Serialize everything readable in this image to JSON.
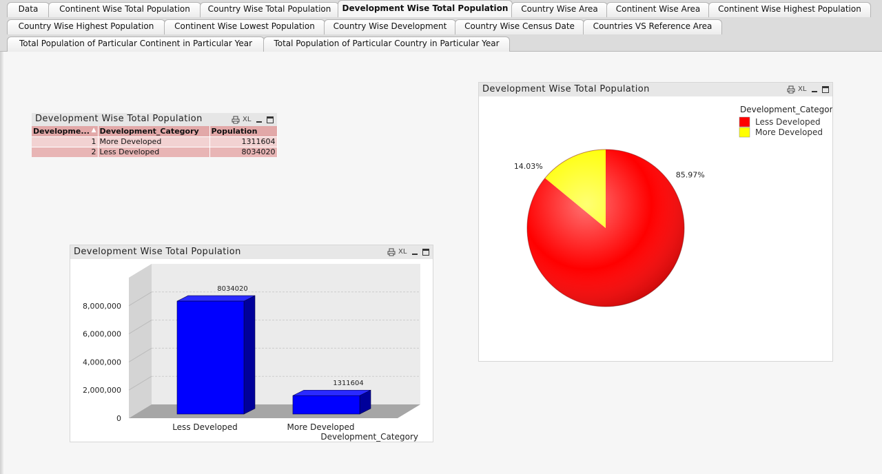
{
  "tabs": {
    "row1": [
      "Data",
      "Continent Wise Total Population",
      "Country Wise Total Population",
      "Development Wise Total Population",
      "Country Wise Area",
      "Continent Wise Area",
      "Continent Wise Highest Population"
    ],
    "row2": [
      "Country Wise Highest Population",
      "Continent Wise Lowest Population",
      "Country Wise Development",
      "Country Wise Census Date",
      "Countries VS Reference Area"
    ],
    "row3": [
      "Total Population of Particular Continent in Particular Year",
      "Total Population of Particular Country in Particular Year"
    ],
    "active": "Development Wise Total Population"
  },
  "caption_icons": {
    "print": "printer-icon",
    "excel": "XL",
    "minimize": "minimize-icon",
    "maximize": "maximize-icon"
  },
  "table": {
    "title": "Development Wise Total Population",
    "columns": [
      "Developme...",
      "Development_Category",
      "Population"
    ],
    "rows": [
      [
        "1",
        "More Developed",
        "1311604"
      ],
      [
        "2",
        "Less Developed",
        "8034020"
      ]
    ]
  },
  "pie": {
    "title": "Development Wise Total Population",
    "legend_title": "Development_Category",
    "colors": {
      "Less Developed": "#ff0000",
      "More Developed": "#ffff00"
    },
    "labels": [
      "14.03%",
      "85.97%"
    ]
  },
  "bar": {
    "title": "Development Wise Total Population",
    "xlabel": "Development_Category",
    "bar_color": "#0000ff"
  },
  "chart_data": [
    {
      "type": "pie",
      "title": "Development Wise Total Population",
      "legend_title": "Development_Category",
      "categories": [
        "Less Developed",
        "More Developed"
      ],
      "values": [
        85.97,
        14.03
      ],
      "legend_position": "top-right"
    },
    {
      "type": "bar",
      "title": "Development Wise Total Population",
      "categories": [
        "Less Developed",
        "More Developed"
      ],
      "values": [
        8034020,
        1311604
      ],
      "data_labels": [
        "8034020",
        "1311604"
      ],
      "xlabel": "Development_Category",
      "ylabel": "",
      "yticks": [
        "0",
        "2,000,000",
        "4,000,000",
        "6,000,000",
        "8,000,000"
      ],
      "ylim": [
        0,
        10000000
      ],
      "grid": true
    }
  ]
}
